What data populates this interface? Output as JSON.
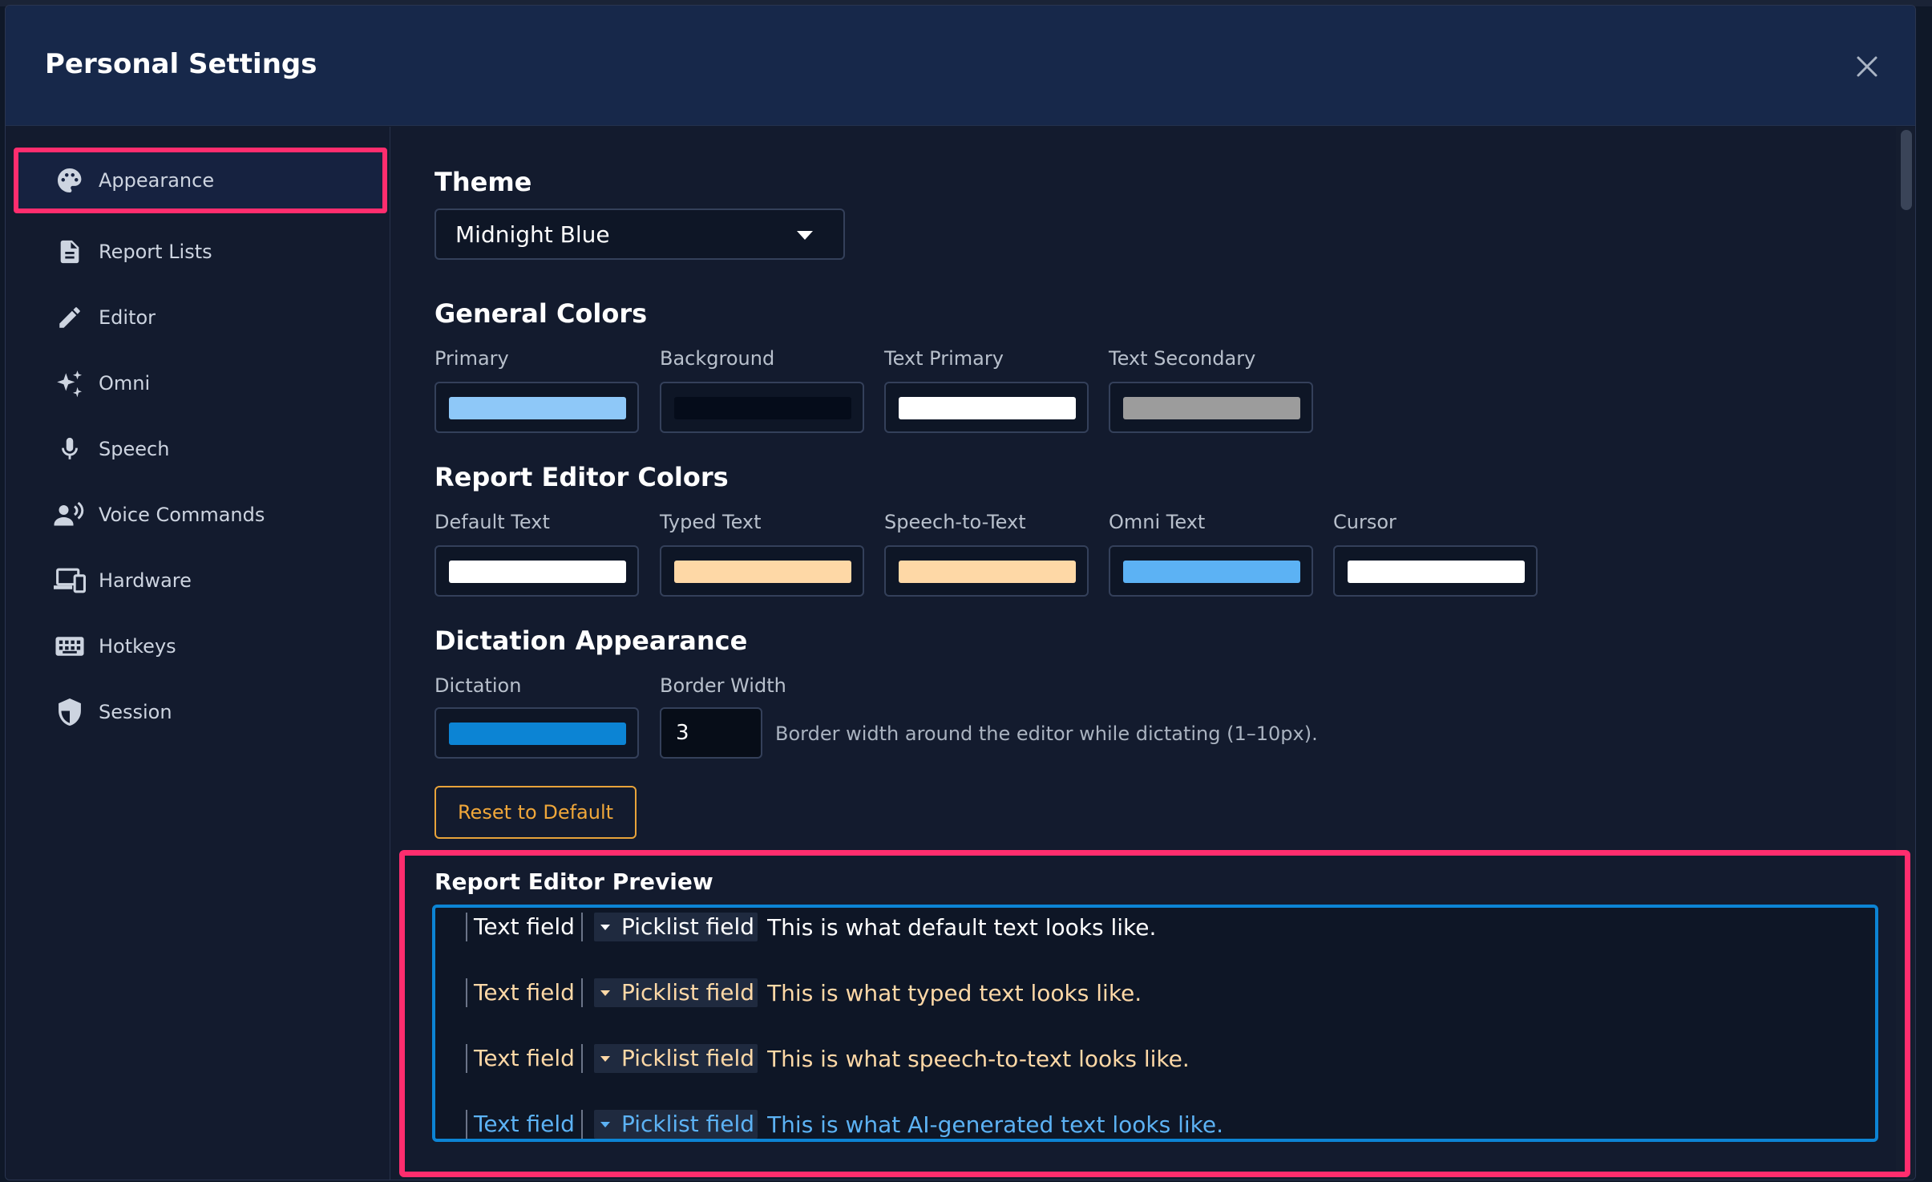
{
  "window": {
    "title": "Personal Settings"
  },
  "sidebar": {
    "items": [
      {
        "label": "Appearance",
        "icon": "palette-icon",
        "active": true
      },
      {
        "label": "Report Lists",
        "icon": "document-icon"
      },
      {
        "label": "Editor",
        "icon": "pencil-icon"
      },
      {
        "label": "Omni",
        "icon": "sparkle-icon"
      },
      {
        "label": "Speech",
        "icon": "microphone-icon"
      },
      {
        "label": "Voice Commands",
        "icon": "voice-user-icon"
      },
      {
        "label": "Hardware",
        "icon": "devices-icon"
      },
      {
        "label": "Hotkeys",
        "icon": "keyboard-icon"
      },
      {
        "label": "Session",
        "icon": "shield-icon"
      }
    ]
  },
  "theme": {
    "heading": "Theme",
    "selected": "Midnight Blue"
  },
  "general_colors": {
    "heading": "General Colors",
    "items": [
      {
        "label": "Primary",
        "color": "#8ec8f8"
      },
      {
        "label": "Background",
        "color": "#050c1a"
      },
      {
        "label": "Text Primary",
        "color": "#ffffff"
      },
      {
        "label": "Text Secondary",
        "color": "#9c9c9c"
      }
    ]
  },
  "editor_colors": {
    "heading": "Report Editor Colors",
    "items": [
      {
        "label": "Default Text",
        "color": "#ffffff"
      },
      {
        "label": "Typed Text",
        "color": "#fed8a6"
      },
      {
        "label": "Speech-to-Text",
        "color": "#fed8a6"
      },
      {
        "label": "Omni Text",
        "color": "#5cb2f4"
      },
      {
        "label": "Cursor",
        "color": "#ffffff"
      }
    ]
  },
  "dictation": {
    "heading": "Dictation Appearance",
    "dictation_label": "Dictation",
    "dictation_color": "#0c84d4",
    "border_label": "Border Width",
    "border_value": "3",
    "hint": "Border width around the editor while dictating (1–10px)."
  },
  "reset_label": "Reset to Default",
  "preview": {
    "heading": "Report Editor Preview",
    "text_field": "Text field",
    "picklist_field": "Picklist field",
    "lines": [
      {
        "sentence": "This is what default text looks like.",
        "color": "#ffffff"
      },
      {
        "sentence": "This is what typed text looks like.",
        "color": "#fed8a6"
      },
      {
        "sentence": "This is what speech-to-text looks like.",
        "color": "#fed8a6"
      },
      {
        "sentence": "This is what AI-generated text looks like.",
        "color": "#5cb2f4"
      }
    ]
  }
}
